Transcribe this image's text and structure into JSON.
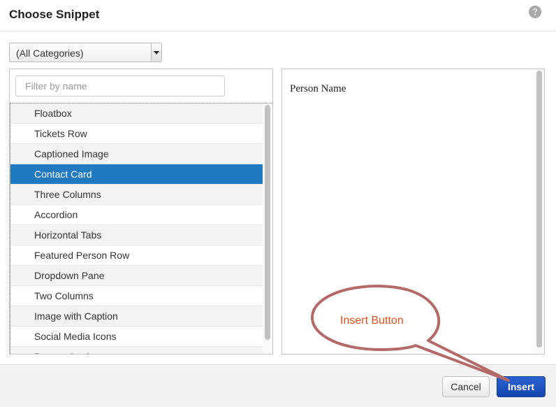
{
  "dialog": {
    "title": "Choose Snippet",
    "help_icon": "question-circle-icon"
  },
  "category_select": {
    "value": "(All Categories)"
  },
  "filter": {
    "placeholder": "Filter by name",
    "value": ""
  },
  "snippets": {
    "items": [
      {
        "label": "Floatbox"
      },
      {
        "label": "Tickets Row"
      },
      {
        "label": "Captioned Image"
      },
      {
        "label": "Contact Card",
        "selected": true
      },
      {
        "label": "Three Columns"
      },
      {
        "label": "Accordion"
      },
      {
        "label": "Horizontal Tabs"
      },
      {
        "label": "Featured Person Row"
      },
      {
        "label": "Dropdown Pane"
      },
      {
        "label": "Two Columns"
      },
      {
        "label": "Image with Caption"
      },
      {
        "label": "Social Media Icons"
      },
      {
        "label": "Person Card"
      }
    ]
  },
  "preview": {
    "text": "Person Name"
  },
  "footer": {
    "cancel_label": "Cancel",
    "insert_label": "Insert"
  },
  "annotation": {
    "label": "Insert Button",
    "color": "#e0501d",
    "stroke_color": "#b56a6a"
  },
  "colors": {
    "selected_row": "#1f7ac0",
    "insert_button": "#1a4fbf"
  }
}
